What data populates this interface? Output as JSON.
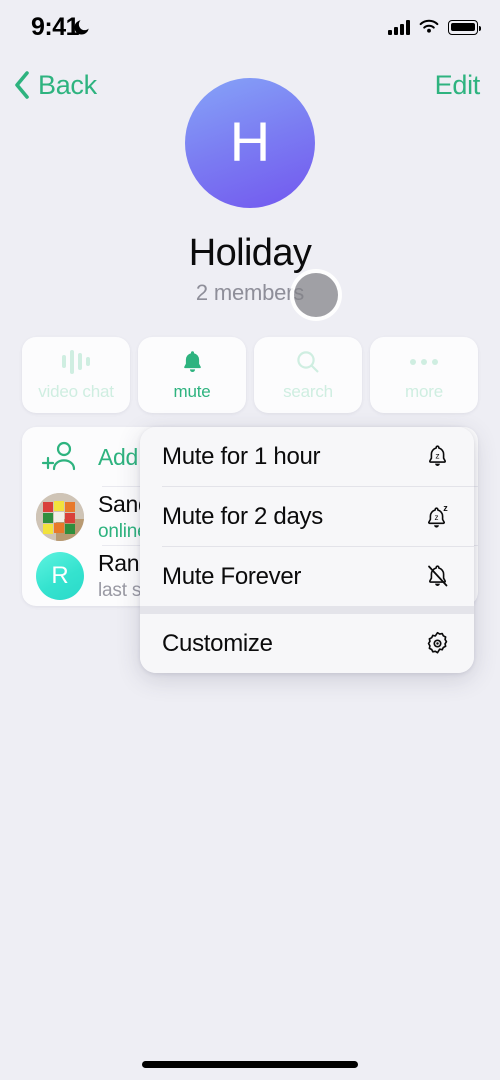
{
  "status_bar": {
    "time": "9:41",
    "dnd_icon": "moon-icon",
    "signal_icon": "cellular-signal-icon",
    "wifi_icon": "wifi-icon",
    "battery_icon": "battery-full-icon"
  },
  "nav": {
    "back_label": "Back",
    "back_icon": "chevron-left-icon",
    "edit_label": "Edit",
    "accent_color": "#2eb37f"
  },
  "profile": {
    "avatar_letter": "H",
    "avatar_gradient_from": "#86a4f8",
    "avatar_gradient_to": "#7257ef",
    "title": "Holiday",
    "subtitle": "2 members"
  },
  "actions": [
    {
      "label": "video chat",
      "icon": "video-chat-waveform-icon",
      "active": false
    },
    {
      "label": "mute",
      "icon": "bell-icon",
      "active": true
    },
    {
      "label": "search",
      "icon": "magnifier-icon",
      "active": false
    },
    {
      "label": "more",
      "icon": "ellipsis-icon",
      "active": false
    }
  ],
  "members_card": {
    "add_member": {
      "label": "Add Member",
      "icon": "person-plus-icon"
    },
    "rows": [
      {
        "name": "Sandra",
        "status": "online",
        "status_online": true,
        "avatar_type": "photo",
        "avatar_image": "rubiks-cube-photo"
      },
      {
        "name": "Randy",
        "status": "last seen recently",
        "status_online": false,
        "avatar_type": "initial",
        "avatar_letter": "R",
        "avatar_color": "#35e3cf"
      }
    ]
  },
  "mute_menu": {
    "groups": [
      {
        "items": [
          {
            "label": "Mute for 1 hour",
            "icon": "bell-snooze-icon"
          },
          {
            "label": "Mute for 2 days",
            "icon": "bell-snooze-z-icon"
          },
          {
            "label": "Mute Forever",
            "icon": "bell-slash-icon"
          }
        ]
      },
      {
        "items": [
          {
            "label": "Customize",
            "icon": "gear-icon"
          }
        ]
      }
    ]
  },
  "home_indicator": {
    "label": "home-indicator"
  }
}
